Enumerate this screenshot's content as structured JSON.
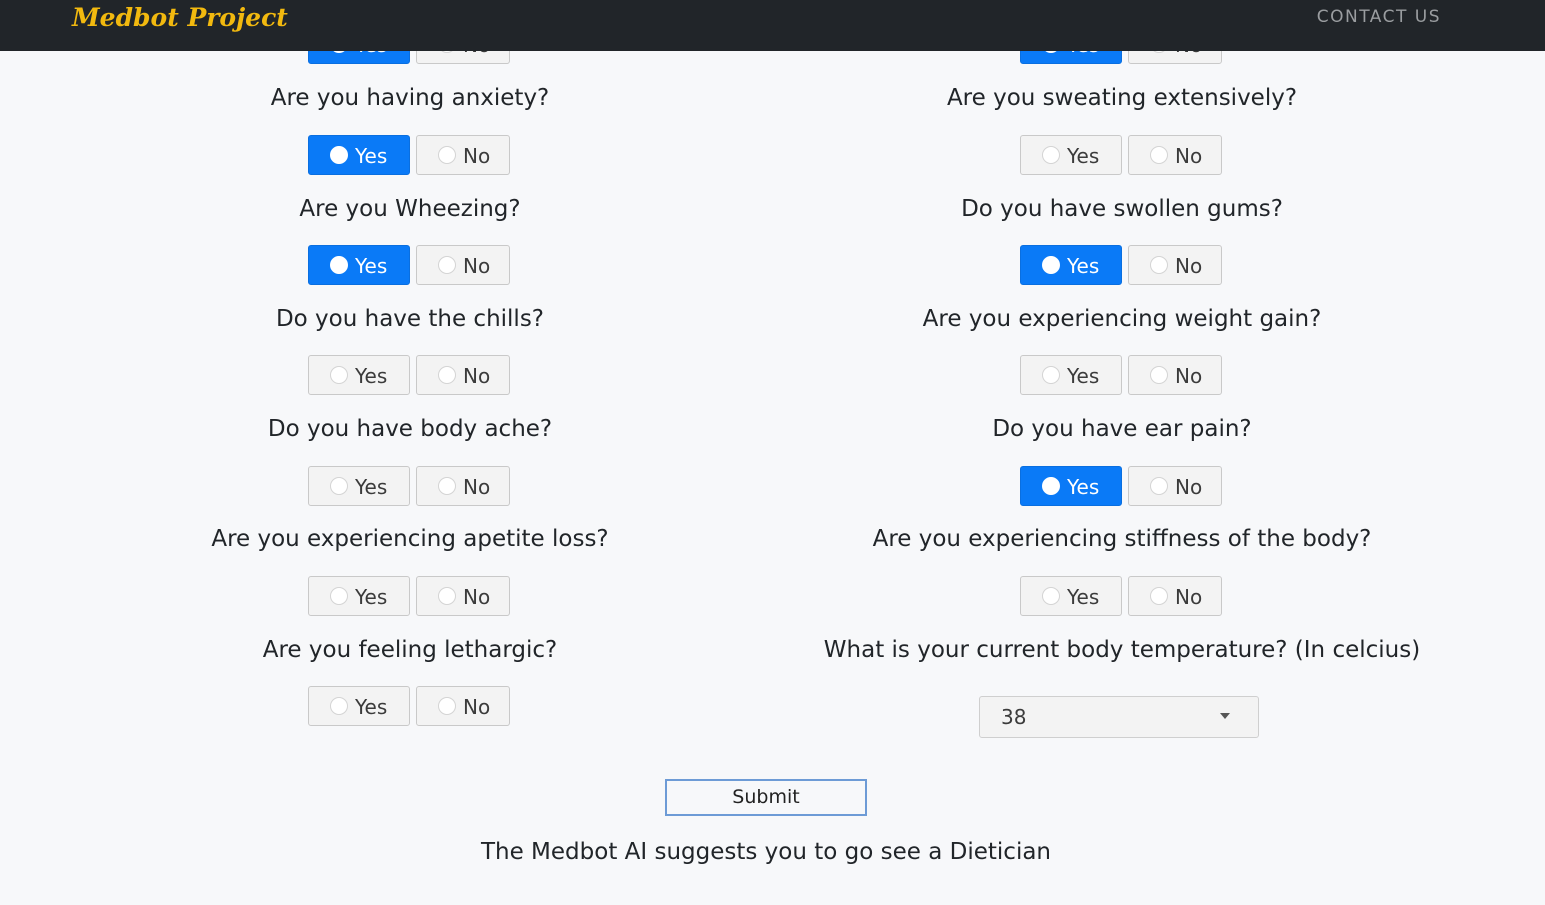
{
  "navbar": {
    "brand": "Medbot Project",
    "contact": "CONTACT US"
  },
  "option_labels": {
    "yes": "Yes",
    "no": "No"
  },
  "left_questions": [
    {
      "text": "Are you having anxiety?",
      "answer": "Yes"
    },
    {
      "text": "Are you Wheezing?",
      "answer": "Yes"
    },
    {
      "text": "Do you have the chills?",
      "answer": null
    },
    {
      "text": "Do you have body ache?",
      "answer": null
    },
    {
      "text": "Are you experiencing apetite loss?",
      "answer": null
    },
    {
      "text": "Are you feeling lethargic?",
      "answer": null
    }
  ],
  "right_questions": [
    {
      "text": "Are you sweating extensively?",
      "answer": null
    },
    {
      "text": "Do you have swollen gums?",
      "answer": "Yes"
    },
    {
      "text": "Are you experiencing weight gain?",
      "answer": null
    },
    {
      "text": "Do you have ear pain?",
      "answer": "Yes"
    },
    {
      "text": "Are you experiencing stiffness of the body?",
      "answer": null
    }
  ],
  "temperature": {
    "question": "What is your current body temperature? (In celcius)",
    "selected": "38"
  },
  "submit_label": "Submit",
  "result_text": "The Medbot AI suggests you to go see a Dietician",
  "colors": {
    "navbar_bg": "#212529",
    "brand": "#f2b90f",
    "active_button": "#0a7af7",
    "page_bg": "#f7f8fa"
  }
}
